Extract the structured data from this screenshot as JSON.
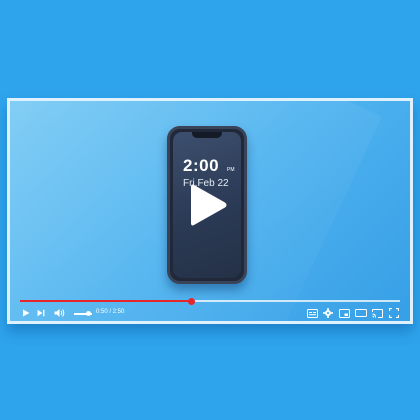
{
  "player": {
    "progress_fraction": 0.45,
    "volume_fraction": 0.8,
    "time_display": "0:50 / 2:50",
    "accent_color": "#e5262a",
    "controls": {
      "left": [
        "play-icon",
        "next-icon",
        "volume-icon"
      ],
      "right": [
        "subtitles-icon",
        "settings-icon",
        "miniplayer-icon",
        "theater-icon",
        "cast-icon",
        "fullscreen-icon"
      ]
    }
  },
  "phone": {
    "time": "2:00",
    "ampm": "PM",
    "date": "Fri,Feb 22"
  },
  "center_overlay": "play-icon"
}
